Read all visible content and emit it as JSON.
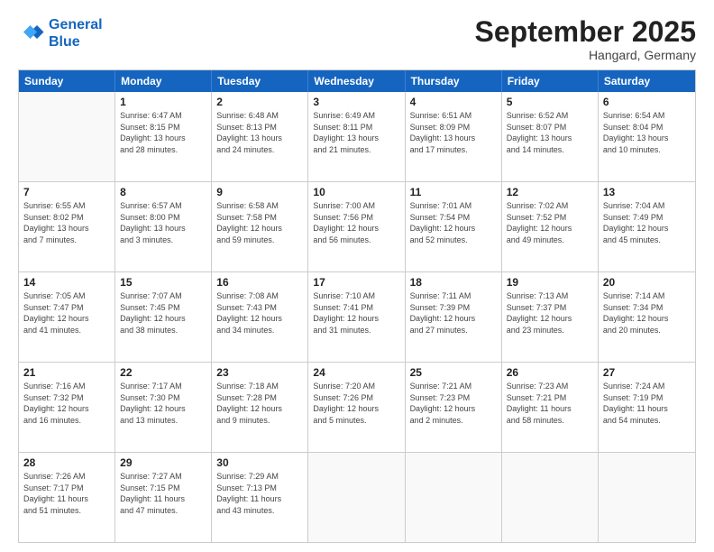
{
  "logo": {
    "line1": "General",
    "line2": "Blue"
  },
  "title": "September 2025",
  "subtitle": "Hangard, Germany",
  "header_days": [
    "Sunday",
    "Monday",
    "Tuesday",
    "Wednesday",
    "Thursday",
    "Friday",
    "Saturday"
  ],
  "rows": [
    [
      {
        "day": "",
        "info": ""
      },
      {
        "day": "1",
        "info": "Sunrise: 6:47 AM\nSunset: 8:15 PM\nDaylight: 13 hours\nand 28 minutes."
      },
      {
        "day": "2",
        "info": "Sunrise: 6:48 AM\nSunset: 8:13 PM\nDaylight: 13 hours\nand 24 minutes."
      },
      {
        "day": "3",
        "info": "Sunrise: 6:49 AM\nSunset: 8:11 PM\nDaylight: 13 hours\nand 21 minutes."
      },
      {
        "day": "4",
        "info": "Sunrise: 6:51 AM\nSunset: 8:09 PM\nDaylight: 13 hours\nand 17 minutes."
      },
      {
        "day": "5",
        "info": "Sunrise: 6:52 AM\nSunset: 8:07 PM\nDaylight: 13 hours\nand 14 minutes."
      },
      {
        "day": "6",
        "info": "Sunrise: 6:54 AM\nSunset: 8:04 PM\nDaylight: 13 hours\nand 10 minutes."
      }
    ],
    [
      {
        "day": "7",
        "info": "Sunrise: 6:55 AM\nSunset: 8:02 PM\nDaylight: 13 hours\nand 7 minutes."
      },
      {
        "day": "8",
        "info": "Sunrise: 6:57 AM\nSunset: 8:00 PM\nDaylight: 13 hours\nand 3 minutes."
      },
      {
        "day": "9",
        "info": "Sunrise: 6:58 AM\nSunset: 7:58 PM\nDaylight: 12 hours\nand 59 minutes."
      },
      {
        "day": "10",
        "info": "Sunrise: 7:00 AM\nSunset: 7:56 PM\nDaylight: 12 hours\nand 56 minutes."
      },
      {
        "day": "11",
        "info": "Sunrise: 7:01 AM\nSunset: 7:54 PM\nDaylight: 12 hours\nand 52 minutes."
      },
      {
        "day": "12",
        "info": "Sunrise: 7:02 AM\nSunset: 7:52 PM\nDaylight: 12 hours\nand 49 minutes."
      },
      {
        "day": "13",
        "info": "Sunrise: 7:04 AM\nSunset: 7:49 PM\nDaylight: 12 hours\nand 45 minutes."
      }
    ],
    [
      {
        "day": "14",
        "info": "Sunrise: 7:05 AM\nSunset: 7:47 PM\nDaylight: 12 hours\nand 41 minutes."
      },
      {
        "day": "15",
        "info": "Sunrise: 7:07 AM\nSunset: 7:45 PM\nDaylight: 12 hours\nand 38 minutes."
      },
      {
        "day": "16",
        "info": "Sunrise: 7:08 AM\nSunset: 7:43 PM\nDaylight: 12 hours\nand 34 minutes."
      },
      {
        "day": "17",
        "info": "Sunrise: 7:10 AM\nSunset: 7:41 PM\nDaylight: 12 hours\nand 31 minutes."
      },
      {
        "day": "18",
        "info": "Sunrise: 7:11 AM\nSunset: 7:39 PM\nDaylight: 12 hours\nand 27 minutes."
      },
      {
        "day": "19",
        "info": "Sunrise: 7:13 AM\nSunset: 7:37 PM\nDaylight: 12 hours\nand 23 minutes."
      },
      {
        "day": "20",
        "info": "Sunrise: 7:14 AM\nSunset: 7:34 PM\nDaylight: 12 hours\nand 20 minutes."
      }
    ],
    [
      {
        "day": "21",
        "info": "Sunrise: 7:16 AM\nSunset: 7:32 PM\nDaylight: 12 hours\nand 16 minutes."
      },
      {
        "day": "22",
        "info": "Sunrise: 7:17 AM\nSunset: 7:30 PM\nDaylight: 12 hours\nand 13 minutes."
      },
      {
        "day": "23",
        "info": "Sunrise: 7:18 AM\nSunset: 7:28 PM\nDaylight: 12 hours\nand 9 minutes."
      },
      {
        "day": "24",
        "info": "Sunrise: 7:20 AM\nSunset: 7:26 PM\nDaylight: 12 hours\nand 5 minutes."
      },
      {
        "day": "25",
        "info": "Sunrise: 7:21 AM\nSunset: 7:23 PM\nDaylight: 12 hours\nand 2 minutes."
      },
      {
        "day": "26",
        "info": "Sunrise: 7:23 AM\nSunset: 7:21 PM\nDaylight: 11 hours\nand 58 minutes."
      },
      {
        "day": "27",
        "info": "Sunrise: 7:24 AM\nSunset: 7:19 PM\nDaylight: 11 hours\nand 54 minutes."
      }
    ],
    [
      {
        "day": "28",
        "info": "Sunrise: 7:26 AM\nSunset: 7:17 PM\nDaylight: 11 hours\nand 51 minutes."
      },
      {
        "day": "29",
        "info": "Sunrise: 7:27 AM\nSunset: 7:15 PM\nDaylight: 11 hours\nand 47 minutes."
      },
      {
        "day": "30",
        "info": "Sunrise: 7:29 AM\nSunset: 7:13 PM\nDaylight: 11 hours\nand 43 minutes."
      },
      {
        "day": "",
        "info": ""
      },
      {
        "day": "",
        "info": ""
      },
      {
        "day": "",
        "info": ""
      },
      {
        "day": "",
        "info": ""
      }
    ]
  ]
}
